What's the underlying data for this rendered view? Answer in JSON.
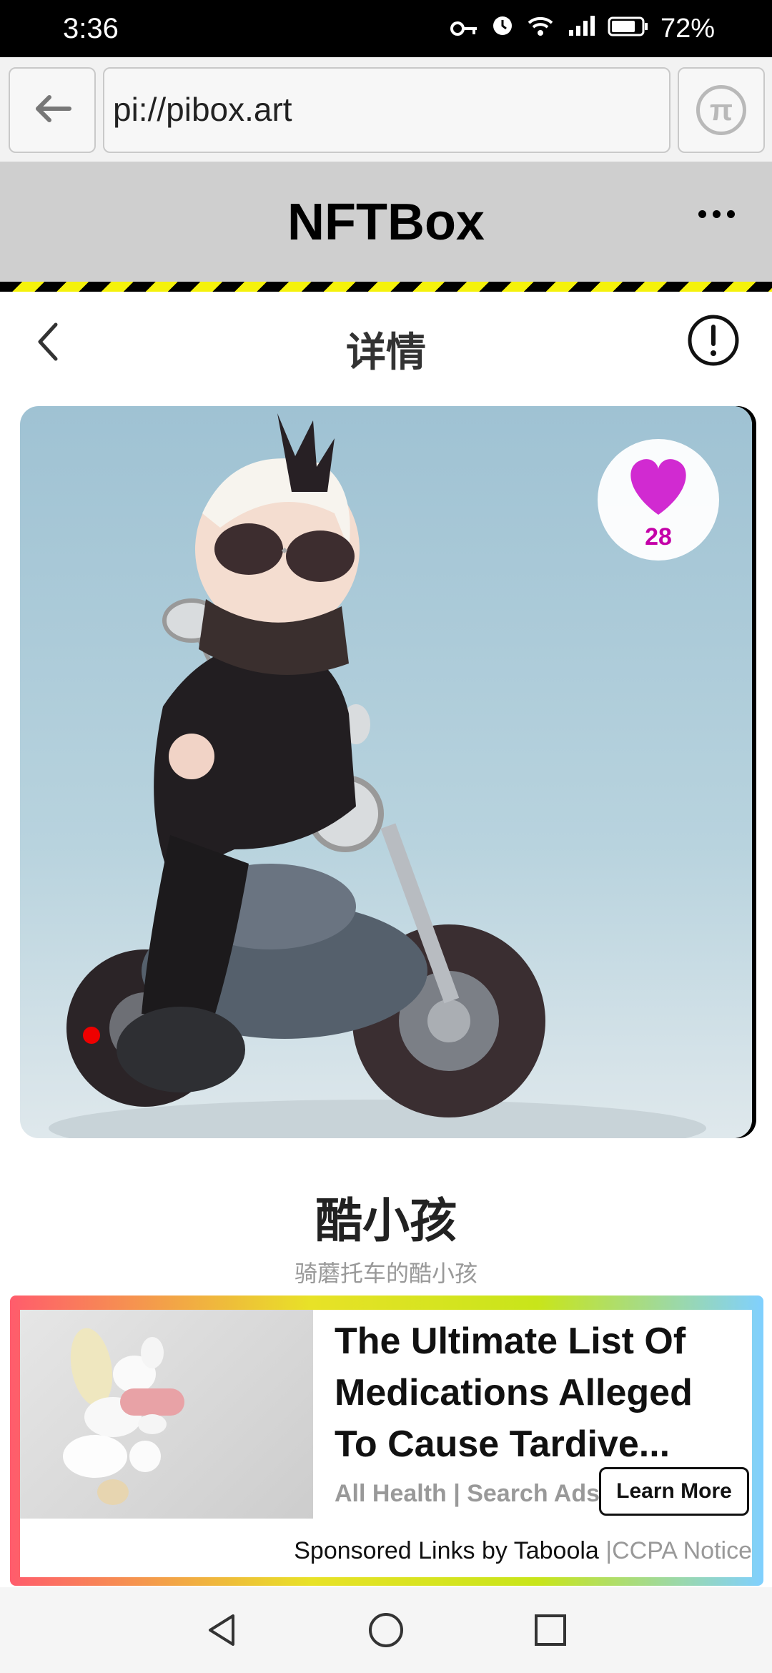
{
  "status_bar": {
    "time": "3:36",
    "battery": "72%",
    "icons": [
      "key-icon",
      "alarm-icon",
      "wifi-icon",
      "signal-4g-icon",
      "battery-icon"
    ]
  },
  "browser": {
    "url": "pi://pibox.art",
    "back_icon": "arrow-left-icon",
    "pi_icon": "pi-logo-icon"
  },
  "app": {
    "title": "NFTBox",
    "menu_icon": "more-horizontal-icon"
  },
  "detail": {
    "title": "详情",
    "back_icon": "chevron-left-icon",
    "info_icon": "info-circle-icon"
  },
  "nft": {
    "likes": "28",
    "like_color": "#d12ad1",
    "name": "酷小孩",
    "description": "骑蘑托车的酷小孩"
  },
  "ad": {
    "headline": "The Ultimate List Of Medications Alleged To Cause Tardive...",
    "source": "All Health | Search Ads",
    "cta": "Learn More",
    "sponsored": "Sponsored Links by Taboola",
    "separator": "|",
    "ccpa": "CCPA Notice"
  },
  "nav": {
    "back": "triangle-back-icon",
    "home": "circle-home-icon",
    "recents": "square-recents-icon"
  }
}
